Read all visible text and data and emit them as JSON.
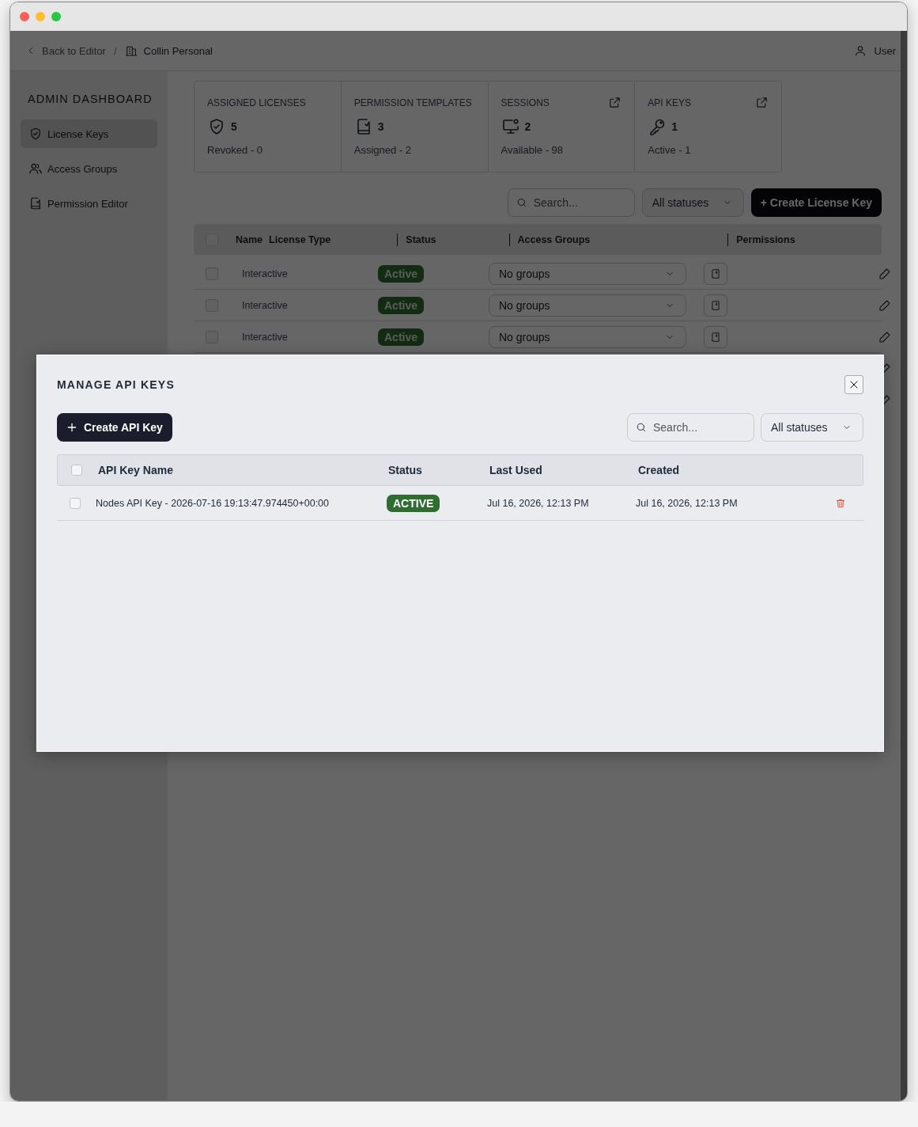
{
  "topbar": {
    "back_link": "Back to Editor",
    "separator": "/",
    "workspace": "Collin Personal",
    "user": "User"
  },
  "sidebar": {
    "title": "ADMIN DASHBOARD",
    "items": [
      {
        "label": "License Keys",
        "selected": true
      },
      {
        "label": "Access Groups",
        "selected": false
      },
      {
        "label": "Permission Editor",
        "selected": false
      }
    ]
  },
  "stats": [
    {
      "title": "ASSIGNED LICENSES",
      "value": "5",
      "detail": "Revoked - 0",
      "external_link": false
    },
    {
      "title": "PERMISSION TEMPLATES",
      "value": "3",
      "detail": "Assigned - 2",
      "external_link": false
    },
    {
      "title": "SESSIONS",
      "value": "2",
      "detail": "Available - 98",
      "external_link": true
    },
    {
      "title": "API KEYS",
      "value": "1",
      "detail": "Active - 1",
      "external_link": true
    }
  ],
  "toolbar": {
    "search_placeholder": "Search...",
    "status_filter": "All statuses",
    "create_button": "+ Create License Key"
  },
  "license_table": {
    "select_all_checked": false,
    "columns": [
      "Name",
      "License Type",
      "Status",
      "Access Groups",
      "Permissions"
    ],
    "rows": [
      {
        "kind": "full",
        "checked": false,
        "license_type": "Interactive",
        "status": "Active",
        "access_groups": "No groups"
      },
      {
        "kind": "full",
        "checked": false,
        "license_type": "Interactive",
        "status": "Active",
        "access_groups": "No groups"
      },
      {
        "kind": "full",
        "checked": false,
        "license_type": "Interactive",
        "status": "Active",
        "access_groups": "No groups"
      },
      {
        "kind": "edit_only"
      },
      {
        "kind": "edit_only"
      }
    ]
  },
  "modal": {
    "title": "MANAGE API KEYS",
    "select_all_checked": false,
    "create_button": "Create API Key",
    "search_placeholder": "Search...",
    "status_filter": "All statuses",
    "columns": [
      "API Key Name",
      "Status",
      "Last Used",
      "Created"
    ],
    "rows": [
      {
        "checked": false,
        "name": "Nodes API Key - 2026-07-16 19:13:47.974450+00:00",
        "status": "ACTIVE",
        "last_used": "Jul 16, 2026, 12:13 PM",
        "created": "Jul 16, 2026, 12:13 PM"
      }
    ]
  }
}
